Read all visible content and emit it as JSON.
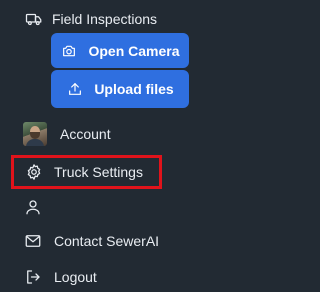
{
  "menu": {
    "field_inspections": {
      "label": "Field Inspections",
      "icon": "truck-icon"
    },
    "open_camera": {
      "label": "Open Camera",
      "icon": "camera-icon"
    },
    "upload_files": {
      "label": "Upload files",
      "icon": "upload-icon"
    },
    "account": {
      "label": "Account",
      "icon": "avatar"
    },
    "truck_settings": {
      "label": "Truck Settings",
      "icon": "gear-icon"
    },
    "profile": {
      "label": "",
      "icon": "person-icon"
    },
    "contact": {
      "label": "Contact SewerAI",
      "icon": "mail-icon"
    },
    "logout": {
      "label": "Logout",
      "icon": "logout-icon"
    }
  },
  "colors": {
    "background": "#222a33",
    "button": "#2f6fe0",
    "highlight": "#e0131b",
    "text": "#e9edf2"
  }
}
